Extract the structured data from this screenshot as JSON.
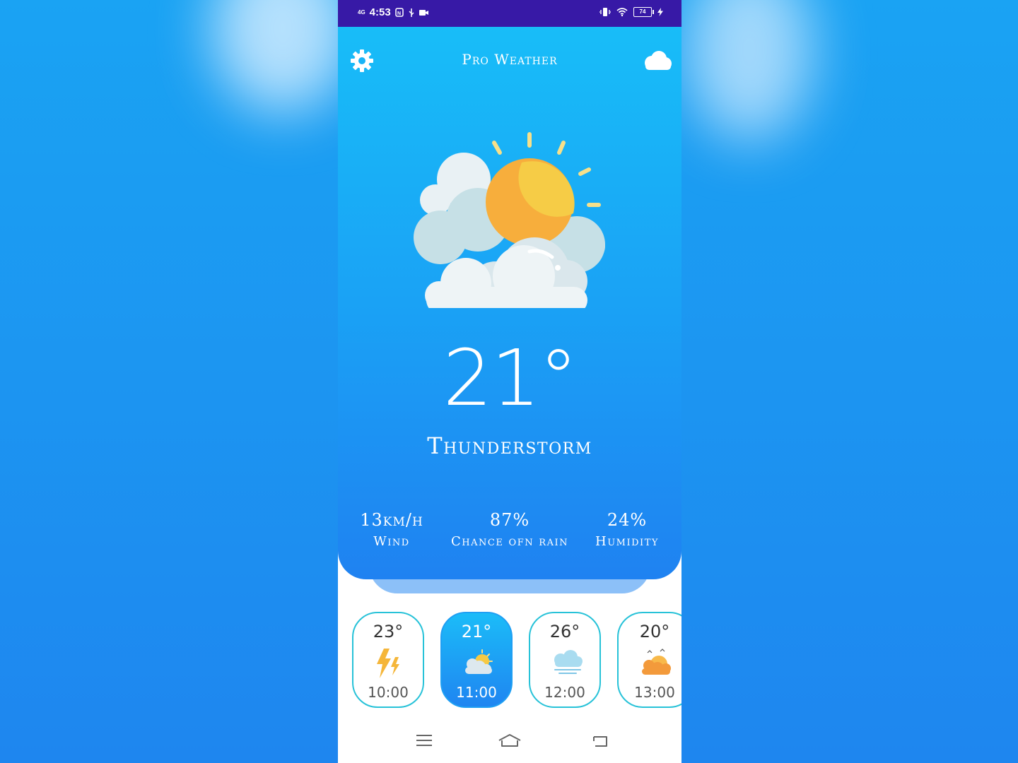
{
  "status_bar": {
    "network": "4G",
    "time": "4:53",
    "battery": "74"
  },
  "header": {
    "title": "Pro Weather",
    "settings_icon": "gear-icon",
    "weather_icon": "cloud-icon"
  },
  "current": {
    "temperature": "21°",
    "condition": "Thunderstorm",
    "icon": "sun-behind-clouds-icon"
  },
  "stats": [
    {
      "value": "13km/h",
      "label": "Wind"
    },
    {
      "value": "87%",
      "label": "Chance ofn rain"
    },
    {
      "value": "24%",
      "label": "Humidity"
    }
  ],
  "hourly": [
    {
      "temp": "23°",
      "time": "10:00",
      "icon": "lightning-icon",
      "active": false
    },
    {
      "temp": "21°",
      "time": "11:00",
      "icon": "sun-cloud-icon",
      "active": true
    },
    {
      "temp": "26°",
      "time": "12:00",
      "icon": "fog-cloud-icon",
      "active": false
    },
    {
      "temp": "20°",
      "time": "13:00",
      "icon": "sunset-clouds-icon",
      "active": false
    }
  ],
  "nav": [
    "menu-icon",
    "home-icon",
    "back-icon"
  ],
  "colors": {
    "status_bar": "#3719a6",
    "hero_top": "#18bdf8",
    "hero_bottom": "#1f82f1",
    "card_border": "#27c2d8",
    "sun": "#f6c944"
  }
}
